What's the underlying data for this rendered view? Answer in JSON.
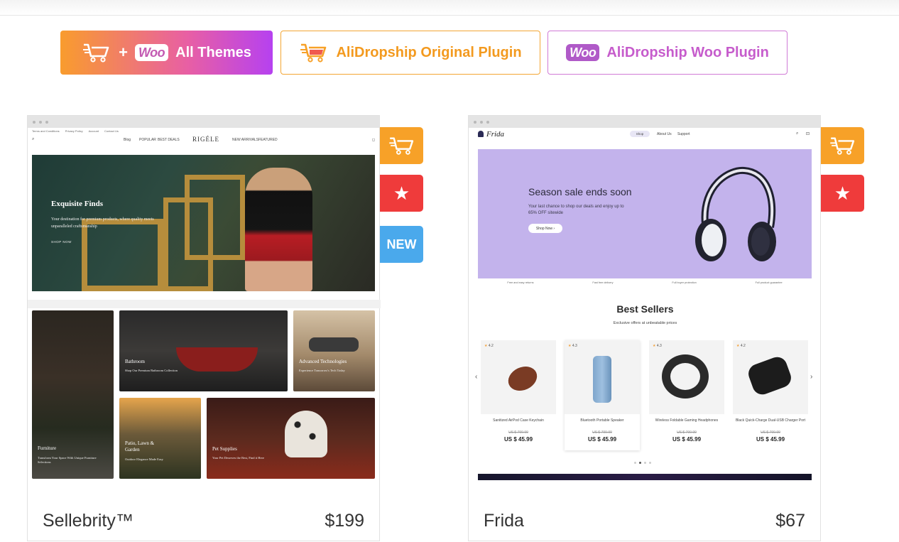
{
  "filters": {
    "all_plus": "+",
    "woo_badge": "Woo",
    "all_label": "All Themes",
    "ali_label": "AliDropship Original Plugin",
    "woo_label": "AliDropship Woo Plugin"
  },
  "colors": {
    "orange": "#f7a128",
    "red": "#ef3b3b",
    "blue": "#4aa9ec",
    "purple": "#b641f0",
    "pink": "#c65ccc"
  },
  "cards": [
    {
      "name": "Sellebrity™",
      "price": "$199",
      "badges": [
        "cart-icon",
        "star-icon",
        "NEW"
      ],
      "preview": {
        "top_links": [
          "Terms and Conditions",
          "Privacy Policy",
          "Account",
          "Contact Us"
        ],
        "nav": [
          "Blog",
          "POPULAR",
          "BEST DEALS",
          "NEW ARRIVALS",
          "FEATURED"
        ],
        "logo": "RIGÉLE",
        "hero_title": "Exquisite Finds",
        "hero_sub": "Your destination for premium products, where quality meets unparalleled craftsmanship",
        "hero_cta": "SHOP NOW",
        "tiles": [
          {
            "label": "Furniture",
            "desc": "Transform Your Space With Unique Furniture Selections"
          },
          {
            "label": "Bathroom",
            "desc": "Shop Our Premium Bathroom Collection"
          },
          {
            "label": "Advanced Technologies",
            "desc": "Experience Tomorrow's Tech Today"
          },
          {
            "label": "Patio, Lawn & Garden",
            "desc": "Outdoor Elegance Made Easy"
          },
          {
            "label": "Pet Supplies",
            "desc": "Your Pet Deserves the Best, Find it Here"
          }
        ]
      }
    },
    {
      "name": "Frida",
      "price": "$67",
      "badges": [
        "cart-icon",
        "star-icon"
      ],
      "preview": {
        "logo": "Frida",
        "nav": [
          "Shop",
          "About Us",
          "Support"
        ],
        "hero_title": "Season sale ends soon",
        "hero_sub": "Your last chance to shop our deals and enjoy up to 65% OFF sitewide",
        "hero_cta": "Shop Now",
        "features": [
          "Free and easy returns",
          "Fast free delivery",
          "Full buyer protection",
          "Full product guarantee"
        ],
        "section_title": "Best Sellers",
        "section_sub": "Exclusive offers at unbeatable prices",
        "products": [
          {
            "rating": "4.2",
            "name": "Sanitized AirPod Case Keychain",
            "old": "US $ 790.99",
            "price": "US $ 45.99"
          },
          {
            "rating": "4.3",
            "name": "Bluetooth Portable Speaker",
            "old": "US $ 790.99",
            "price": "US $ 45.99"
          },
          {
            "rating": "4.3",
            "name": "Wireless Foldable Gaming Headphones",
            "old": "US $ 790.99",
            "price": "US $ 45.99"
          },
          {
            "rating": "4.2",
            "name": "Black Quick-Charge Dual-USB Charger Port",
            "old": "US $ 790.99",
            "price": "US $ 45.99"
          }
        ]
      }
    }
  ]
}
